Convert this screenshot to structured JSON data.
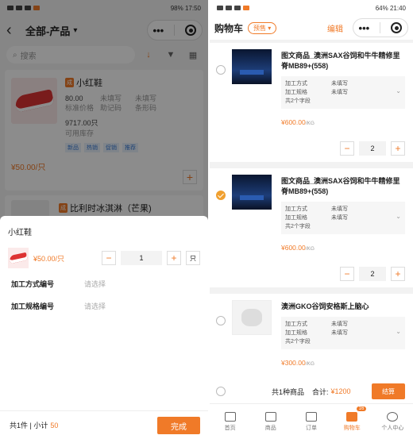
{
  "left": {
    "status": {
      "time": "17:50",
      "battery": "98%"
    },
    "title": "全部-产品",
    "search_placeholder": "搜索",
    "product1": {
      "tag": "成",
      "name": "小红鞋",
      "price": "80.00",
      "price_label": "标准价格",
      "code_value": "未填写",
      "code_label": "助记码",
      "barcode_value": "未填写",
      "barcode_label": "条形码",
      "stock": "9717.00只",
      "stock_label": "可用库存",
      "tags": [
        "新品",
        "热销",
        "促销",
        "推荐"
      ],
      "unit_price": "¥50.00/只"
    },
    "product2": {
      "tag": "成",
      "name": "比利时冰淇淋（芒果)"
    },
    "sheet": {
      "title": "小红鞋",
      "price": "¥50.00/只",
      "qty": "1",
      "unit": "只",
      "fields": [
        {
          "label": "加工方式编号",
          "value": "请选择"
        },
        {
          "label": "加工规格编号",
          "value": "请选择"
        }
      ],
      "count_text": "共1件 | 小计",
      "subtotal": "50",
      "done": "完成"
    }
  },
  "right": {
    "status": {
      "time": "21:40",
      "battery": "64%"
    },
    "title": "购物车",
    "presale": "预售",
    "edit": "编辑",
    "items": [
      {
        "name": "图文商品_澳洲SAX谷饲和牛牛精修里脊MB89+(558)",
        "spec1_k": "加工方式",
        "spec1_v": "未填写",
        "spec2_k": "加工规格",
        "spec2_v": "未填写",
        "more": "共2个字段",
        "price": "¥600.00",
        "per": "/KG",
        "qty": "2",
        "checked": false
      },
      {
        "name": "图文商品_澳洲SAX谷饲和牛牛精修里脊MB89+(558)",
        "spec1_k": "加工方式",
        "spec1_v": "未填写",
        "spec2_k": "加工规格",
        "spec2_v": "未填写",
        "more": "共2个字段",
        "price": "¥600.00",
        "per": "/KG",
        "qty": "2",
        "checked": true
      },
      {
        "name": "澳洲GKO谷饲安格斯上脑心",
        "spec1_k": "加工方式",
        "spec1_v": "未填写",
        "spec2_k": "加工规格",
        "spec2_v": "未填写",
        "more": "共2个字段",
        "price": "¥300.00",
        "per": "/KG"
      }
    ],
    "footer": {
      "count": "共1种商品",
      "total_label": "合计:",
      "total": "¥1200",
      "settle": "结算"
    },
    "tabs": [
      {
        "label": "首页"
      },
      {
        "label": "商品"
      },
      {
        "label": "订单"
      },
      {
        "label": "购物车",
        "badge": "16"
      },
      {
        "label": "个人中心"
      }
    ]
  }
}
